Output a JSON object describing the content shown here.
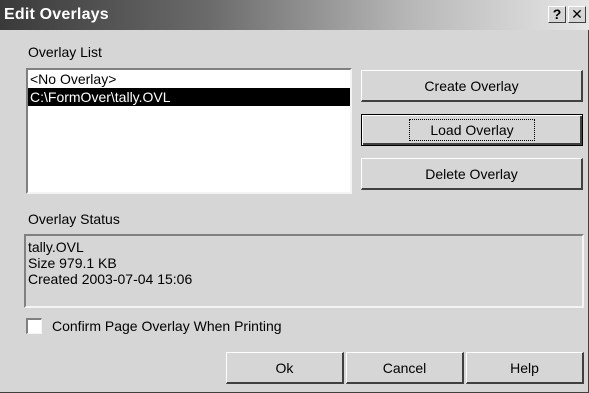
{
  "window": {
    "title": "Edit Overlays",
    "help_glyph": "?",
    "close_glyph": "✕"
  },
  "overlay_list": {
    "label": "Overlay List",
    "items": [
      "<No Overlay>",
      "C:\\FormOver\\tally.OVL"
    ],
    "selected_index": 1
  },
  "actions": {
    "create": "Create Overlay",
    "load": "Load Overlay",
    "delete": "Delete Overlay"
  },
  "status": {
    "label": "Overlay Status",
    "lines": [
      "tally.OVL",
      "Size 979.1 KB",
      "Created 2003-07-04 15:06"
    ]
  },
  "options": {
    "confirm_label": "Confirm Page Overlay When Printing",
    "confirm_checked": false
  },
  "footer": {
    "ok": "Ok",
    "cancel": "Cancel",
    "help": "Help"
  },
  "icons": [
    "help-icon",
    "close-icon"
  ]
}
